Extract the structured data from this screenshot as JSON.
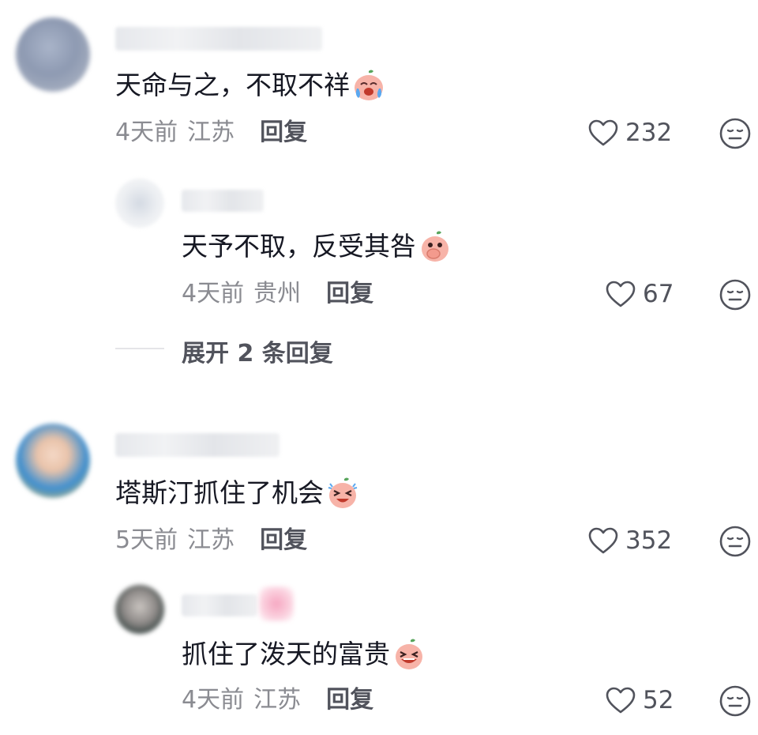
{
  "comments": [
    {
      "text": "天命与之，不取不祥",
      "time": "4天前",
      "location": "江苏",
      "reply_label": "回复",
      "likes": "232",
      "emoji": "crying-emoji",
      "replies": [
        {
          "text": "天予不取，反受其咎",
          "time": "4天前",
          "location": "贵州",
          "reply_label": "回复",
          "likes": "67",
          "emoji": "covering-mouth-emoji"
        }
      ],
      "expand_label": "展开 2 条回复"
    },
    {
      "text": "塔斯汀抓住了机会",
      "time": "5天前",
      "location": "江苏",
      "reply_label": "回复",
      "likes": "352",
      "emoji": "laughing-tears-emoji",
      "replies": [
        {
          "text": "抓住了泼天的富贵",
          "time": "4天前",
          "location": "江苏",
          "reply_label": "回复",
          "likes": "52",
          "emoji": "grinning-emoji"
        }
      ]
    }
  ],
  "icons": {
    "like": "heart-outline-icon",
    "dislike": "meh-face-icon"
  },
  "colors": {
    "text_primary": "#161823",
    "text_secondary": "#8a8b91",
    "action": "#51535c",
    "emoji_skin": "#f7b3a8"
  }
}
